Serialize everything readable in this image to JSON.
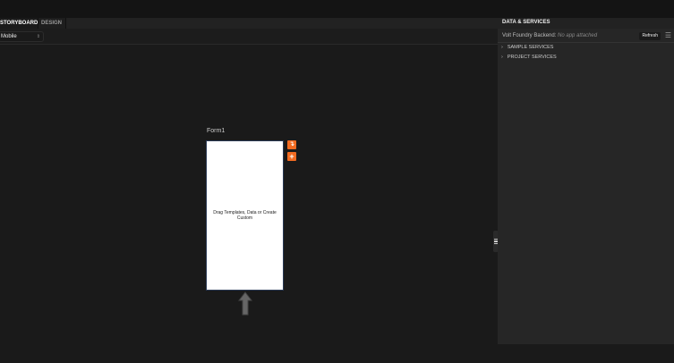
{
  "tabs": [
    "STORYBOARD",
    "DESIGN"
  ],
  "device_select": {
    "value": "Mobile"
  },
  "canvas": {
    "form_title": "Form1",
    "form_placeholder": "Drag Templates, Data or Create Custom"
  },
  "panel": {
    "title": "DATA & SERVICES",
    "backend_label": "Volt Foundry Backend:",
    "backend_value": "No app attached",
    "refresh_label": "Refresh",
    "tree": [
      "SAMPLE SERVICES",
      "PROJECT SERVICES"
    ]
  },
  "colors": {
    "accent": "#f26b21"
  }
}
